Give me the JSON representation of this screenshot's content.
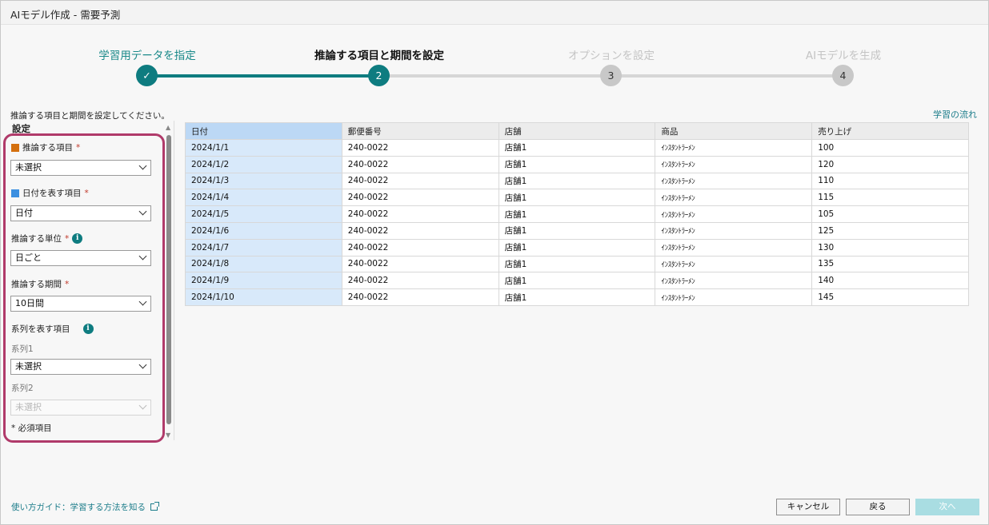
{
  "window": {
    "title": "AIモデル作成 - 需要予測"
  },
  "stepper": {
    "steps": [
      {
        "label": "学習用データを指定",
        "marker": "✓",
        "state": "done"
      },
      {
        "label": "推論する項目と期間を設定",
        "marker": "2",
        "state": "active"
      },
      {
        "label": "オプションを設定",
        "marker": "3",
        "state": "pending"
      },
      {
        "label": "AIモデルを生成",
        "marker": "4",
        "state": "pending"
      }
    ]
  },
  "instruction": "推論する項目と期間を設定してください。",
  "flow_link": "学習の流れ",
  "settings": {
    "heading": "設定",
    "required_mark": "*",
    "target_item": {
      "label": "推論する項目",
      "value": "未選択",
      "swatch_color": "#d4700f"
    },
    "date_item": {
      "label": "日付を表す項目",
      "value": "日付",
      "swatch_color": "#3b8fe0"
    },
    "unit": {
      "label": "推論する単位",
      "value": "日ごと",
      "info_icon": "i"
    },
    "period": {
      "label": "推論する期間",
      "value": "10日間"
    },
    "series": {
      "label": "系列を表す項目",
      "info_icon": "i",
      "series1": {
        "label": "系列1",
        "value": "未選択"
      },
      "series2": {
        "label": "系列2",
        "value": "未選択"
      }
    },
    "footnote": "* 必須項目"
  },
  "table": {
    "columns": [
      "日付",
      "郵便番号",
      "店舗",
      "商品",
      "売り上げ"
    ],
    "rows": [
      [
        "2024/1/1",
        "240-0022",
        "店舗1",
        "ｲﾝｽﾀﾝﾄﾗｰﾒﾝ",
        "100"
      ],
      [
        "2024/1/2",
        "240-0022",
        "店舗1",
        "ｲﾝｽﾀﾝﾄﾗｰﾒﾝ",
        "120"
      ],
      [
        "2024/1/3",
        "240-0022",
        "店舗1",
        "ｲﾝｽﾀﾝﾄﾗｰﾒﾝ",
        "110"
      ],
      [
        "2024/1/4",
        "240-0022",
        "店舗1",
        "ｲﾝｽﾀﾝﾄﾗｰﾒﾝ",
        "115"
      ],
      [
        "2024/1/5",
        "240-0022",
        "店舗1",
        "ｲﾝｽﾀﾝﾄﾗｰﾒﾝ",
        "105"
      ],
      [
        "2024/1/6",
        "240-0022",
        "店舗1",
        "ｲﾝｽﾀﾝﾄﾗｰﾒﾝ",
        "125"
      ],
      [
        "2024/1/7",
        "240-0022",
        "店舗1",
        "ｲﾝｽﾀﾝﾄﾗｰﾒﾝ",
        "130"
      ],
      [
        "2024/1/8",
        "240-0022",
        "店舗1",
        "ｲﾝｽﾀﾝﾄﾗｰﾒﾝ",
        "135"
      ],
      [
        "2024/1/9",
        "240-0022",
        "店舗1",
        "ｲﾝｽﾀﾝﾄﾗｰﾒﾝ",
        "140"
      ],
      [
        "2024/1/10",
        "240-0022",
        "店舗1",
        "ｲﾝｽﾀﾝﾄﾗｰﾒﾝ",
        "145"
      ]
    ]
  },
  "footer": {
    "guide_link": "使い方ガイド：学習する方法を知る",
    "cancel": "キャンセル",
    "back": "戻る",
    "next": "次へ"
  },
  "colors": {
    "accent": "#0e7c80",
    "highlight_frame": "#b03a6a",
    "date_column_header": "#bcd8f5",
    "date_column_cells": "#d8e9fa"
  }
}
